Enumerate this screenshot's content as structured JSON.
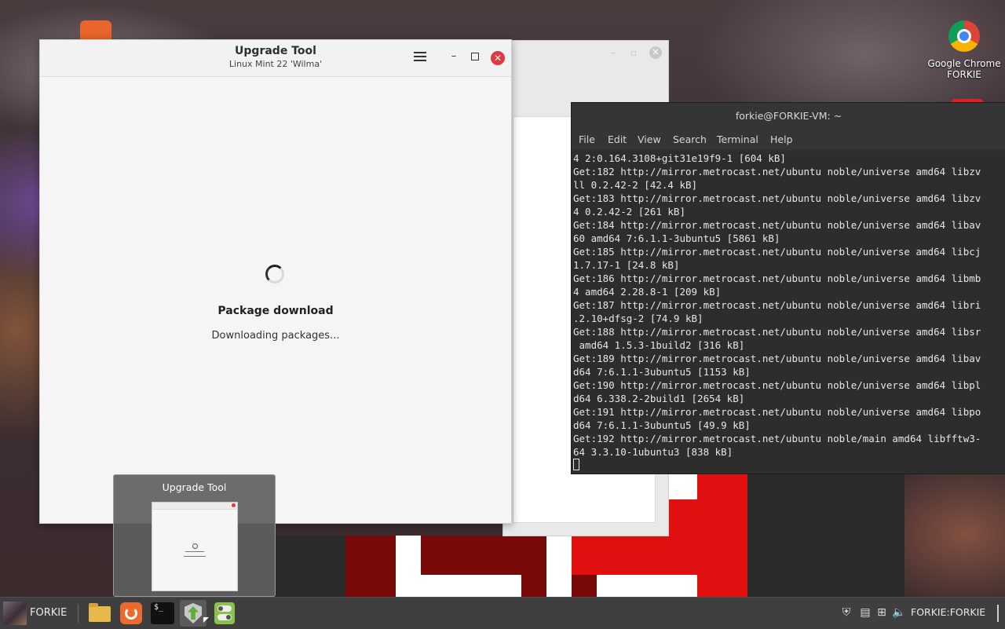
{
  "desktop": {
    "icons": [
      {
        "label_line1": "Google Chrome",
        "label_line2": "FORKIE",
        "icon": "chrome-icon"
      }
    ]
  },
  "upgrade_tool": {
    "title": "Upgrade Tool",
    "subtitle": "Linux Mint 22 'Wilma'",
    "heading": "Package download",
    "status": "Downloading packages...",
    "icons": {
      "menu": "hamburger-menu-icon",
      "minimize": "minimize-icon",
      "maximize": "maximize-icon",
      "close": "close-icon",
      "spinner": "loading-spinner-icon"
    },
    "colors": {
      "close": "#e0393e"
    }
  },
  "terminal": {
    "title": "forkie@FORKIE-VM: ~",
    "menu": [
      "File",
      "Edit",
      "View",
      "Search",
      "Terminal",
      "Help"
    ],
    "lines": [
      "4 2:0.164.3108+git31e19f9-1 [604 kB]",
      "Get:182 http://mirror.metrocast.net/ubuntu noble/universe amd64 libzv",
      "ll 0.2.42-2 [42.4 kB]",
      "Get:183 http://mirror.metrocast.net/ubuntu noble/universe amd64 libzv",
      "4 0.2.42-2 [261 kB]",
      "Get:184 http://mirror.metrocast.net/ubuntu noble/universe amd64 libav",
      "60 amd64 7:6.1.1-3ubuntu5 [5861 kB]",
      "Get:185 http://mirror.metrocast.net/ubuntu noble/universe amd64 libcj",
      "1.7.17-1 [24.8 kB]",
      "Get:186 http://mirror.metrocast.net/ubuntu noble/universe amd64 libmb",
      "4 amd64 2.28.8-1 [209 kB]",
      "Get:187 http://mirror.metrocast.net/ubuntu noble/universe amd64 libri",
      ".2.10+dfsg-2 [74.9 kB]",
      "Get:188 http://mirror.metrocast.net/ubuntu noble/universe amd64 libsr",
      " amd64 1.5.3-1build2 [316 kB]",
      "Get:189 http://mirror.metrocast.net/ubuntu noble/universe amd64 libav",
      "d64 7:6.1.1-3ubuntu5 [1153 kB]",
      "Get:190 http://mirror.metrocast.net/ubuntu noble/universe amd64 libpl",
      "d64 6.338.2-2build1 [2654 kB]",
      "Get:191 http://mirror.metrocast.net/ubuntu noble/universe amd64 libpo",
      "d64 7:6.1.1-3ubuntu5 [49.9 kB]",
      "Get:192 http://mirror.metrocast.net/ubuntu noble/main amd64 libfftw3-",
      "64 3.3.10-1ubuntu3 [838 kB]"
    ]
  },
  "window_preview": {
    "title": "Upgrade Tool"
  },
  "taskbar": {
    "menu_label": "FORKIE",
    "apps": [
      {
        "name": "files",
        "icon": "folder-icon"
      },
      {
        "name": "firefox",
        "icon": "firefox-icon"
      },
      {
        "name": "terminal",
        "icon": "terminal-icon"
      },
      {
        "name": "upgrade-tool",
        "icon": "upgrade-shield-icon",
        "active": true
      },
      {
        "name": "settings",
        "icon": "toggle-settings-icon"
      }
    ],
    "tray": {
      "icons": [
        "shield-icon",
        "clipboard-icon",
        "network-icon",
        "volume-icon"
      ],
      "user": "FORKIE:FORKIE"
    }
  }
}
